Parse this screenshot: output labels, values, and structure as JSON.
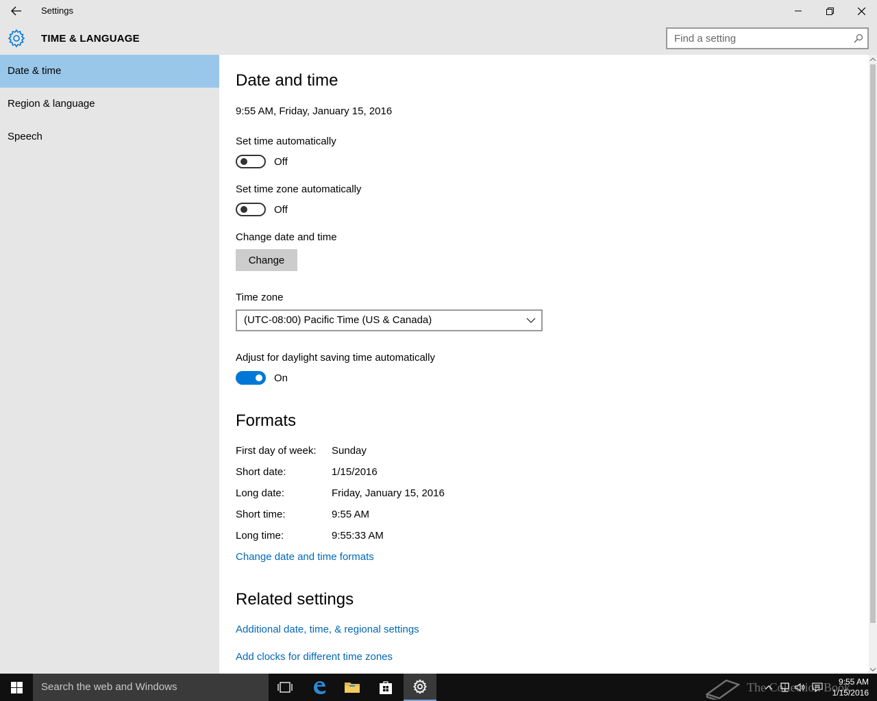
{
  "window": {
    "title": "Settings",
    "section_title": "TIME & LANGUAGE"
  },
  "search": {
    "placeholder": "Find a setting"
  },
  "sidebar": {
    "items": [
      {
        "label": "Date & time",
        "active": true
      },
      {
        "label": "Region & language",
        "active": false
      },
      {
        "label": "Speech",
        "active": false
      }
    ]
  },
  "main": {
    "heading": "Date and time",
    "current_datetime": "9:55 AM, Friday, January 15, 2016",
    "set_time_auto": {
      "label": "Set time automatically",
      "state": "Off"
    },
    "set_tz_auto": {
      "label": "Set time zone automatically",
      "state": "Off"
    },
    "change_dt": {
      "label": "Change date and time",
      "button": "Change"
    },
    "timezone": {
      "label": "Time zone",
      "value": "(UTC-08:00) Pacific Time (US & Canada)"
    },
    "dst": {
      "label": "Adjust for daylight saving time automatically",
      "state": "On"
    },
    "formats": {
      "heading": "Formats",
      "rows": [
        {
          "label": "First day of week:",
          "value": "Sunday"
        },
        {
          "label": "Short date:",
          "value": "1/15/2016"
        },
        {
          "label": "Long date:",
          "value": "Friday, January 15, 2016"
        },
        {
          "label": "Short time:",
          "value": "9:55 AM"
        },
        {
          "label": "Long time:",
          "value": "9:55:33 AM"
        }
      ],
      "change_link": "Change date and time formats"
    },
    "related": {
      "heading": "Related settings",
      "links": [
        "Additional date, time, & regional settings",
        "Add clocks for different time zones"
      ]
    }
  },
  "taskbar": {
    "search_placeholder": "Search the web and Windows",
    "watermark": "The Collection Book",
    "clock_time": "9:55 AM",
    "clock_date": "1/15/2016"
  },
  "colors": {
    "accent": "#0078d7",
    "link": "#0067b8",
    "nav_active": "#99c7ea",
    "chrome": "#e6e6e6",
    "taskbar": "#101010"
  }
}
